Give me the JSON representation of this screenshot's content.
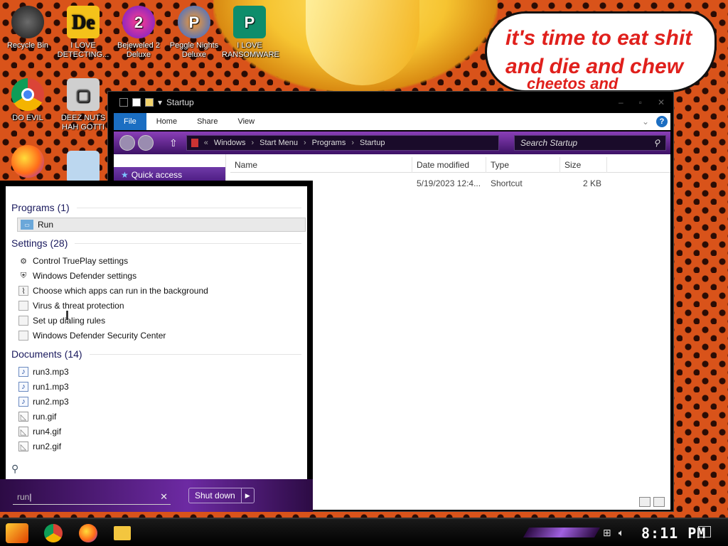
{
  "desktop": {
    "icons": [
      {
        "label": "Recycle Bin",
        "glyph": ""
      },
      {
        "label": "I LOVE DETECTING...",
        "glyph": "De"
      },
      {
        "label": "Bejeweled 2 Deluxe",
        "glyph": "2"
      },
      {
        "label": "Peggle Nights Deluxe",
        "glyph": "P"
      },
      {
        "label": "I LOVE RANSOMWARE",
        "glyph": "P"
      },
      {
        "label": "DO EVIL",
        "glyph": ""
      },
      {
        "label": "DEEZ NUTS HAH GOTTI",
        "glyph": "▢"
      }
    ],
    "bubble": {
      "line1": "it's time to eat shit",
      "line2": "and die and chew",
      "line3": "cheetos and"
    }
  },
  "explorer": {
    "title": "Startup",
    "ribbon": {
      "file": "File",
      "home": "Home",
      "share": "Share",
      "view": "View",
      "help": "?"
    },
    "breadcrumb": [
      "Windows",
      "Start Menu",
      "Programs",
      "Startup"
    ],
    "search_placeholder": "Search Startup",
    "quick_access": "Quick access",
    "columns": {
      "name": "Name",
      "date": "Date modified",
      "type": "Type",
      "size": "Size"
    },
    "files": [
      {
        "name": "",
        "date": "5/19/2023 12:4...",
        "type": "Shortcut",
        "size": "2 KB"
      }
    ]
  },
  "start_menu": {
    "programs": {
      "header": "Programs (1)",
      "items": [
        {
          "label": "Run",
          "icon": "run-icon"
        }
      ]
    },
    "settings": {
      "header": "Settings (28)",
      "items": [
        {
          "label": "Control TruePlay settings",
          "icon": "gear-icon"
        },
        {
          "label": "Windows Defender settings",
          "icon": "shield-icon"
        },
        {
          "label": "Choose which apps can run in the background",
          "icon": "chart-icon"
        },
        {
          "label": "Virus & threat protection",
          "icon": "page-icon"
        },
        {
          "label": "Set up dialing rules",
          "icon": "page-icon"
        },
        {
          "label": "Windows Defender Security Center",
          "icon": "page-icon"
        }
      ]
    },
    "documents": {
      "header": "Documents (14)",
      "items": [
        {
          "label": "run3.mp3",
          "icon": "music-file-icon"
        },
        {
          "label": "run1.mp3",
          "icon": "music-file-icon"
        },
        {
          "label": "run2.mp3",
          "icon": "music-file-icon"
        },
        {
          "label": "run.gif",
          "icon": "image-file-icon"
        },
        {
          "label": "run4.gif",
          "icon": "image-file-icon"
        },
        {
          "label": "run2.gif",
          "icon": "image-file-icon"
        }
      ]
    },
    "search_value": "run",
    "shutdown_label": "Shut down"
  },
  "taskbar": {
    "clock": "8:11 PM"
  }
}
